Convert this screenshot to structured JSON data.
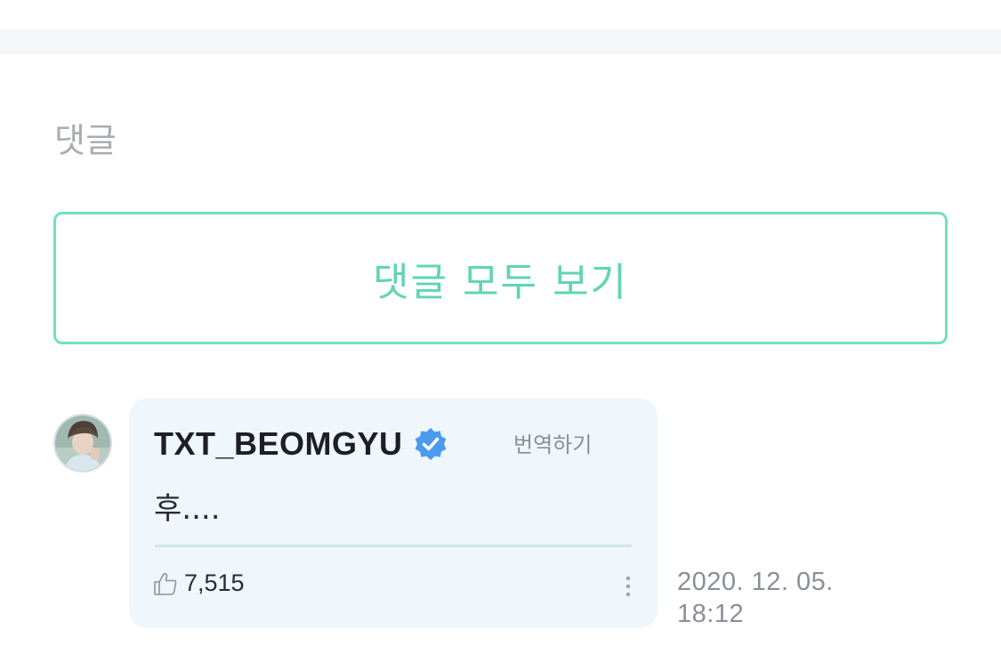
{
  "section": {
    "title": "댓글"
  },
  "view_all_button": {
    "label": "댓글 모두 보기"
  },
  "comment": {
    "author": "TXT_BEOMGYU",
    "verified_icon": "verified-badge-icon",
    "translate_label": "번역하기",
    "body": "후....",
    "like_icon": "thumbs-up-icon",
    "like_count": "7,515",
    "more_icon": "vertical-dots-icon",
    "timestamp_date": "2020. 12. 05.",
    "timestamp_time": "18:12"
  },
  "colors": {
    "accent": "#72dfc0",
    "accent_text": "#5fd5b3",
    "bubble_bg": "#eff7fc",
    "verified": "#4a9af0",
    "muted_text": "#8a8f97"
  }
}
